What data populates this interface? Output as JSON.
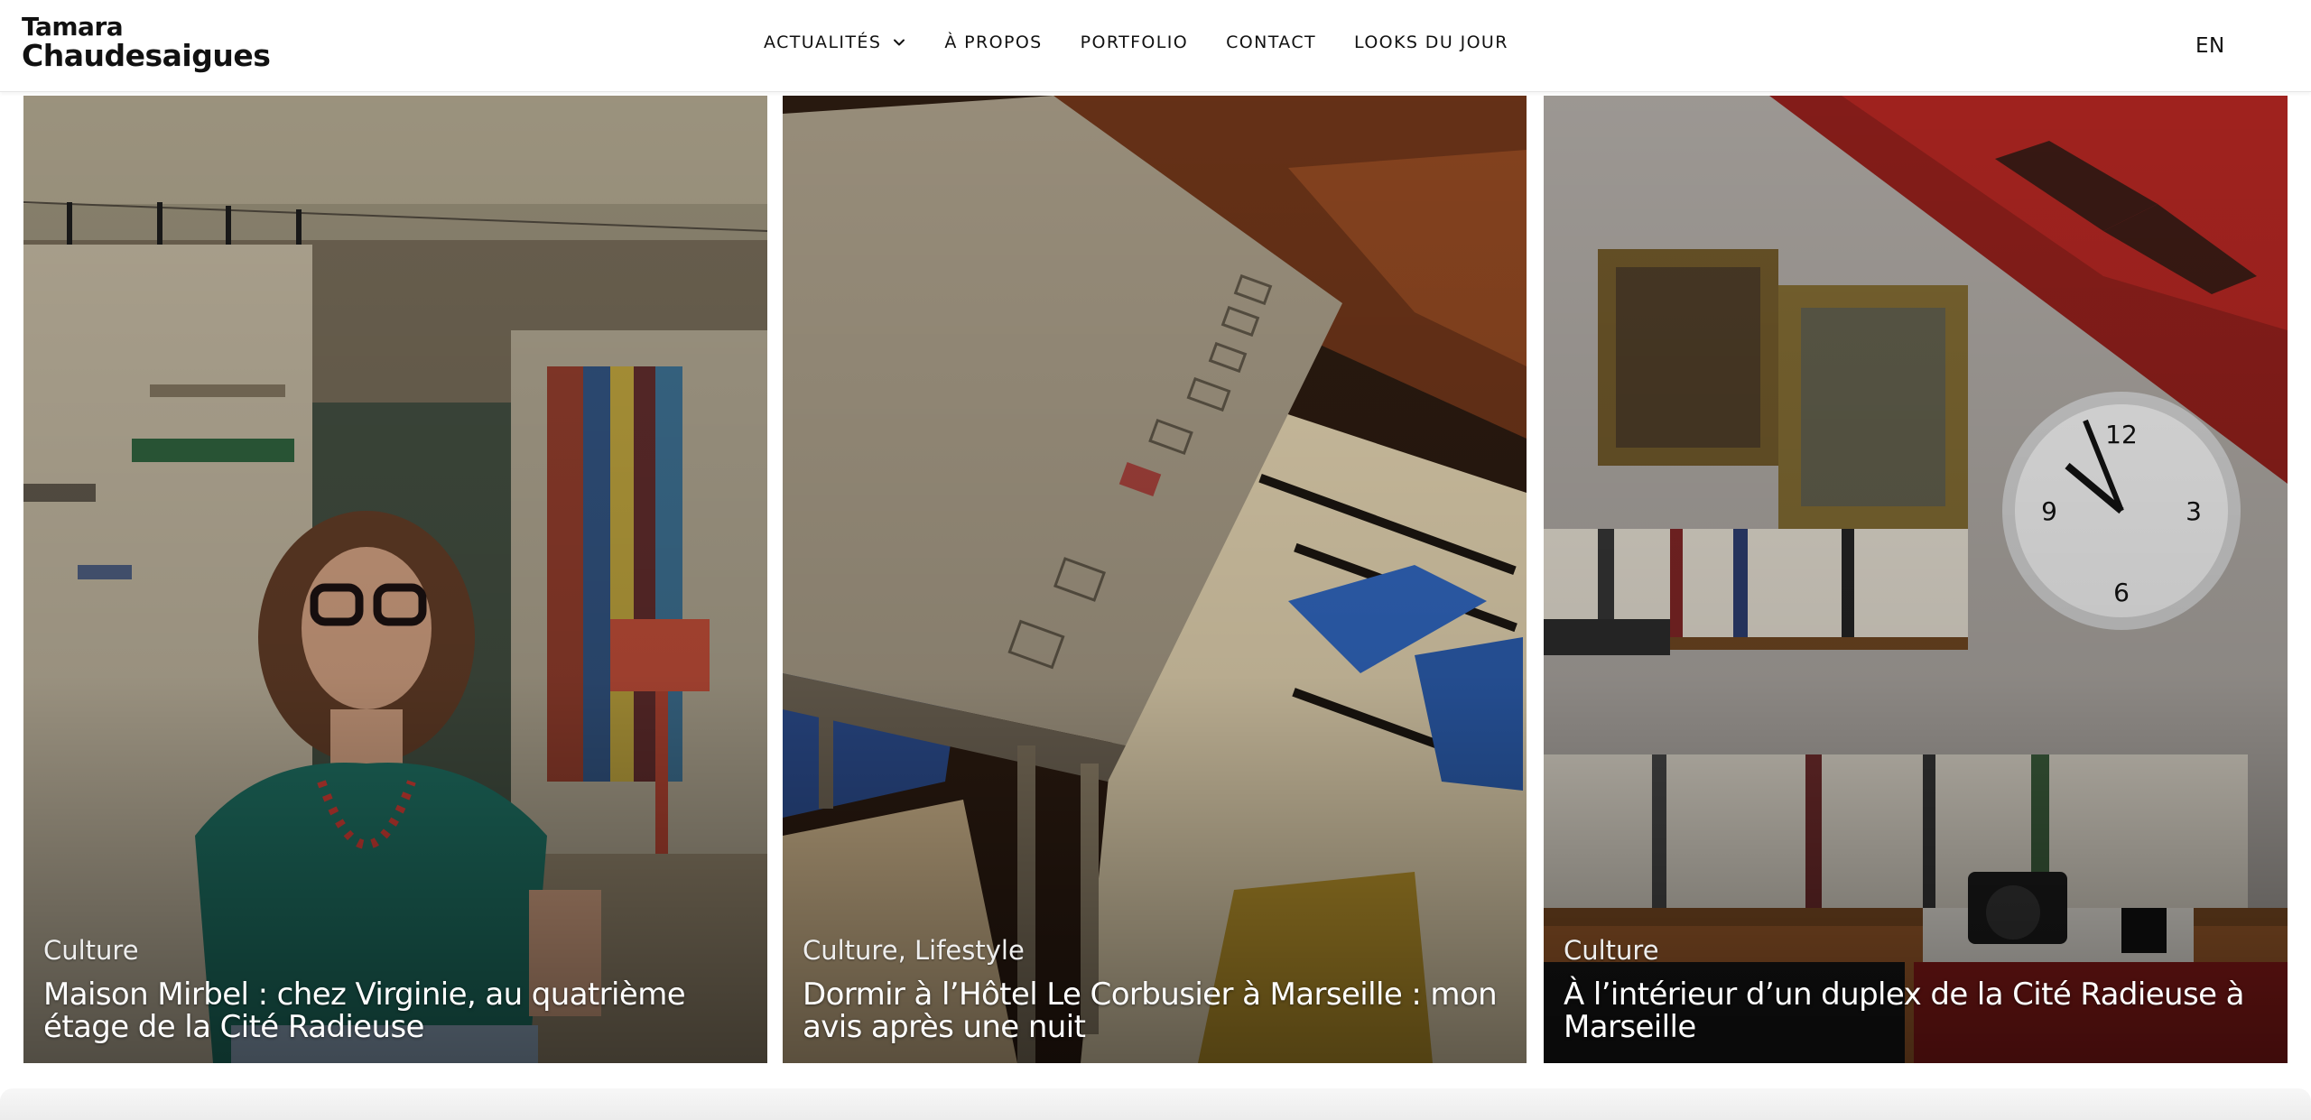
{
  "site": {
    "logo_line1": "Tamara",
    "logo_line2": "Chaudesaigues"
  },
  "nav": {
    "items": [
      {
        "label": "ACTUALITÉS",
        "has_dropdown": true
      },
      {
        "label": "À PROPOS"
      },
      {
        "label": "PORTFOLIO"
      },
      {
        "label": "CONTACT"
      },
      {
        "label": "LOOKS DU JOUR"
      }
    ],
    "language": "EN"
  },
  "cards": [
    {
      "category": "Culture",
      "title": "Maison Mirbel : chez Virginie, au quatrième étage de la Cité Radieuse"
    },
    {
      "category": "Culture, Lifestyle",
      "title": "Dormir à l’Hôtel Le Corbusier à Marseille : mon avis après une nuit"
    },
    {
      "category": "Culture",
      "title": "À l’intérieur d’un duplex de la Cité Radieuse à Marseille"
    }
  ],
  "colors": {
    "text": "#111111",
    "overlay_text": "#ffffff",
    "stair_red": "#b8231f",
    "teal_top": "#1a7a6a",
    "rug_blue": "#2f63b8"
  },
  "icons": {
    "dropdown": "chevron-down-icon"
  }
}
